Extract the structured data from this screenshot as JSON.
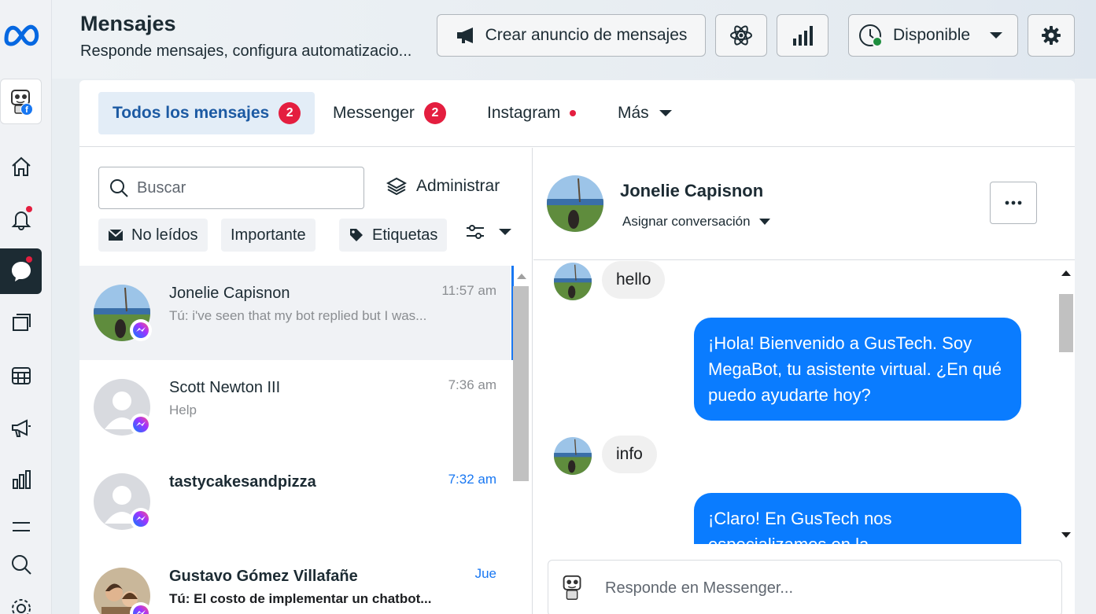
{
  "header": {
    "title": "Mensajes",
    "subtitle": "Responde mensajes, configura automatizacio...",
    "create_ad_label": "Crear anuncio de mensajes",
    "status_label": "Disponible"
  },
  "tabs": [
    {
      "label": "Todos los mensajes",
      "count": "2"
    },
    {
      "label": "Messenger",
      "count": "2"
    },
    {
      "label": "Instagram"
    },
    {
      "label": "Más"
    }
  ],
  "list": {
    "search_placeholder": "Buscar",
    "manage_label": "Administrar",
    "filters": [
      "No leídos",
      "Importante",
      "Etiquetas"
    ],
    "conversations": [
      {
        "name": "Jonelie Capisnon",
        "preview": "Tú: i've seen that my bot replied but I was...",
        "time": "11:57 am"
      },
      {
        "name": "Scott Newton III",
        "preview": "Help",
        "time": "7:36 am"
      },
      {
        "name": "tastycakesandpizza",
        "preview": "",
        "time": "7:32 am"
      },
      {
        "name": "Gustavo Gómez Villafañe",
        "preview": "Tú: El costo de implementar un chatbot...",
        "time": "Jue"
      }
    ]
  },
  "chat": {
    "contact_name": "Jonelie Capisnon",
    "assign_label": "Asignar conversación",
    "messages": [
      {
        "from": "contact",
        "text": "hello"
      },
      {
        "from": "page",
        "text": "¡Hola! Bienvenido a GusTech. Soy MegaBot, tu asistente virtual. ¿En qué puedo ayudarte hoy?"
      },
      {
        "from": "contact",
        "text": "info"
      },
      {
        "from": "page",
        "text": "¡Claro! En GusTech nos especializamos en la"
      }
    ],
    "composer_placeholder": "Responde en Messenger..."
  },
  "colors": {
    "accent": "#1877f2",
    "bubble_out": "#0a7cff",
    "badge": "#e41e3f",
    "status_online": "#1e8e3e"
  }
}
